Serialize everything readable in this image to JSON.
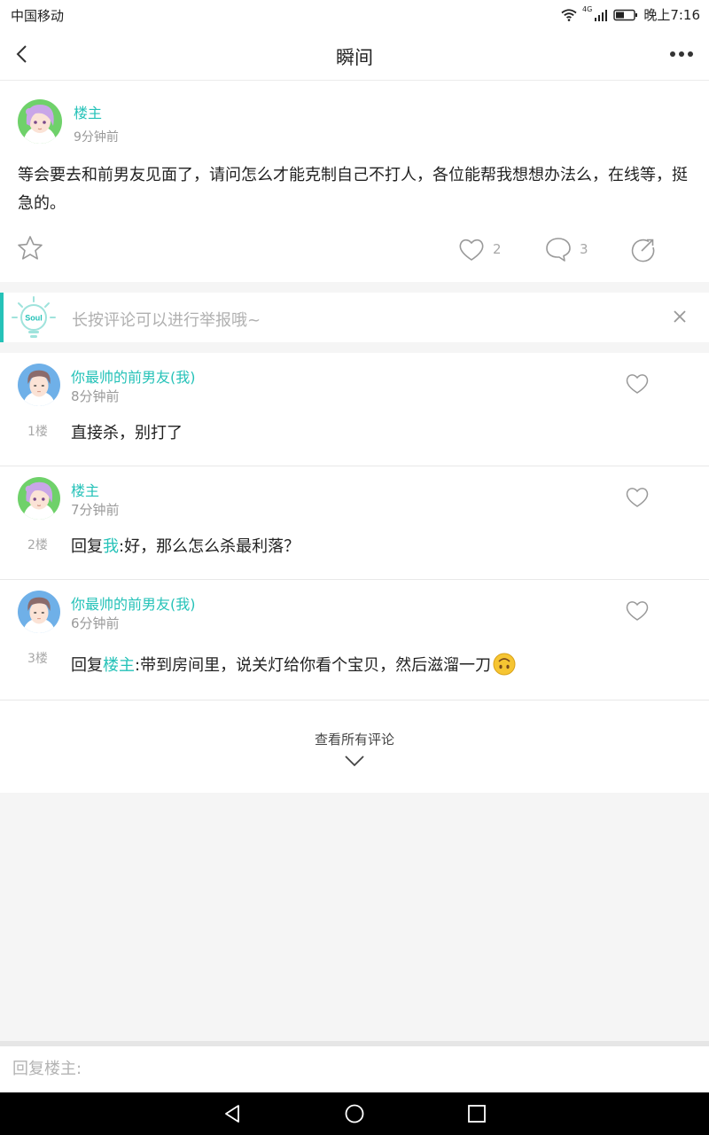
{
  "status_bar": {
    "carrier": "中国移动",
    "network": "4G",
    "time": "晚上7:16"
  },
  "header": {
    "title": "瞬间",
    "back_icon": "chevron-left-icon",
    "more_icon": "more-horizontal-icon"
  },
  "post": {
    "author": "楼主",
    "time": "9分钟前",
    "content": "等会要去和前男友见面了，请问怎么才能克制自己不打人，各位能帮我想想办法么，在线等，挺急的。",
    "likes": "2",
    "comments": "3"
  },
  "tip": {
    "text": "长按评论可以进行举报哦~",
    "bulb_label": "Soul"
  },
  "comments": [
    {
      "author": "你最帅的前男友(我)",
      "time": "8分钟前",
      "floor": "1楼",
      "text": "直接杀，别打了"
    },
    {
      "author": "楼主",
      "time": "7分钟前",
      "floor": "2楼",
      "prefix": "回复",
      "mention": "我",
      "text": ":好，那么怎么杀最利落？"
    },
    {
      "author": "你最帅的前男友(我)",
      "time": "6分钟前",
      "floor": "3楼",
      "prefix": "回复",
      "mention": "楼主",
      "text": ":带到房间里，说关灯给你看个宝贝，然后滋溜一刀"
    }
  ],
  "view_all": {
    "label": "查看所有评论"
  },
  "reply": {
    "placeholder": "回复楼主:"
  },
  "colors": {
    "accent": "#25c2b8",
    "muted": "#9a9a9a"
  }
}
